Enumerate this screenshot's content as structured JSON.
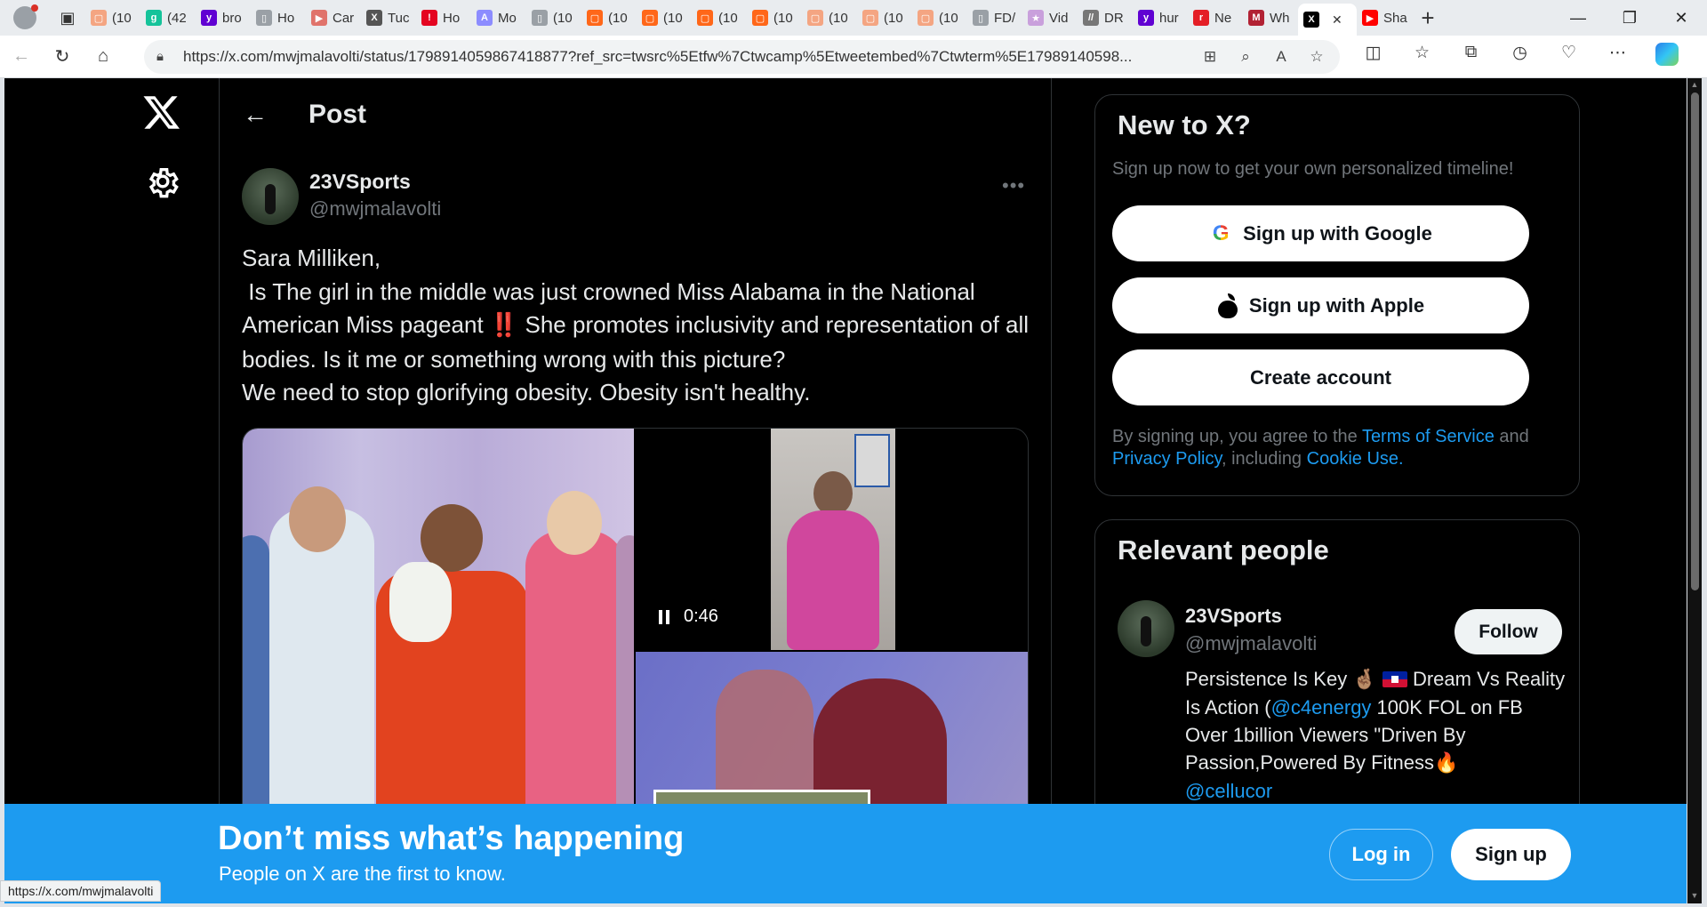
{
  "browser": {
    "tabs": [
      {
        "label": "(10",
        "fav_color": "#f4a582",
        "fav_glyph": "▢"
      },
      {
        "label": "(42",
        "fav_color": "#15c39a",
        "fav_glyph": "g"
      },
      {
        "label": "bro",
        "fav_color": "#6001d2",
        "fav_glyph": "y"
      },
      {
        "label": "Ho",
        "fav_color": "#9aa0a6",
        "fav_glyph": "▯"
      },
      {
        "label": "Car",
        "fav_color": "#e0736b",
        "fav_glyph": "▶"
      },
      {
        "label": "Tuc",
        "fav_color": "#555555",
        "fav_glyph": "X"
      },
      {
        "label": "Ho",
        "fav_color": "#e40521",
        "fav_glyph": "!"
      },
      {
        "label": "Mo",
        "fav_color": "#8c8cff",
        "fav_glyph": "A"
      },
      {
        "label": "(10",
        "fav_color": "#9aa0a6",
        "fav_glyph": "▯"
      },
      {
        "label": "(10",
        "fav_color": "#ff6719",
        "fav_glyph": "▢"
      },
      {
        "label": "(10",
        "fav_color": "#ff6719",
        "fav_glyph": "▢"
      },
      {
        "label": "(10",
        "fav_color": "#ff6719",
        "fav_glyph": "▢"
      },
      {
        "label": "(10",
        "fav_color": "#ff6719",
        "fav_glyph": "▢"
      },
      {
        "label": "(10",
        "fav_color": "#f4a582",
        "fav_glyph": "▢"
      },
      {
        "label": "(10",
        "fav_color": "#f4a582",
        "fav_glyph": "▢"
      },
      {
        "label": "(10",
        "fav_color": "#f4a582",
        "fav_glyph": "▢"
      },
      {
        "label": "FD/",
        "fav_color": "#9aa0a6",
        "fav_glyph": "▯"
      },
      {
        "label": "Vid",
        "fav_color": "#c9a0dc",
        "fav_glyph": "★"
      },
      {
        "label": "DR",
        "fav_color": "#777777",
        "fav_glyph": "//"
      },
      {
        "label": "hur",
        "fav_color": "#6001d2",
        "fav_glyph": "y"
      },
      {
        "label": "Ne",
        "fav_color": "#e41e26",
        "fav_glyph": "r"
      },
      {
        "label": "Wh",
        "fav_color": "#b22234",
        "fav_glyph": "M"
      },
      {
        "label": "",
        "fav_color": "#000000",
        "fav_glyph": "X",
        "active": true
      },
      {
        "label": "Sha",
        "fav_color": "#ff0000",
        "fav_glyph": "▶"
      }
    ],
    "url": "https://x.com/mwjmalavolti/status/1798914059867418877?ref_src=twsrc%5Etfw%7Ctwcamp%5Etweetembed%7Ctwterm%5E17989140598...",
    "status_url": "https://x.com/mwjmalavolti"
  },
  "post": {
    "header_title": "Post",
    "author_name": "23VSports",
    "author_handle": "@mwjmalavolti",
    "text_line1": "Sara Milliken,",
    "text_line2": " Is The girl in the middle was just crowned Miss Alabama in the National American Miss pageant ",
    "text_bang": "‼️",
    "text_line3": " She promotes inclusivity and representation of all bodies. Is it me or something wrong with this picture?",
    "text_line4": "We need to stop glorifying obesity. Obesity isn't healthy.",
    "video_time": "0:46"
  },
  "signup_card": {
    "title": "New to X?",
    "subtitle": "Sign up now to get your own personalized timeline!",
    "google_label": "Sign up with Google",
    "apple_label": "Sign up with Apple",
    "create_label": "Create account",
    "legal_prefix": "By signing up, you agree to the ",
    "terms": "Terms of Service",
    "and": " and ",
    "privacy": "Privacy Policy",
    "including": ", including ",
    "cookie": "Cookie Use."
  },
  "relevant_people": {
    "title": "Relevant people",
    "name": "23VSports",
    "handle": "@mwjmalavolti",
    "follow_label": "Follow",
    "bio_part1": "Persistence Is Key ",
    "bio_emoji1": "🤞🏽",
    "bio_part2": " Dream Vs Reality Is Action (",
    "bio_link1": "@c4energy",
    "bio_part3": " 100K FOL on FB Over 1billion Viewers \"Driven By Passion,Powered By Fitness",
    "bio_emoji2": "🔥",
    "bio_link2": "@cellucor"
  },
  "banner": {
    "headline": "Don’t miss what’s happening",
    "subline": "People on X are the first to know.",
    "login_label": "Log in",
    "signup_label": "Sign up"
  },
  "colors": {
    "x_blue": "#1d9bf0",
    "background": "#000000",
    "text_primary": "#e7e9ea",
    "text_secondary": "#71767b"
  }
}
